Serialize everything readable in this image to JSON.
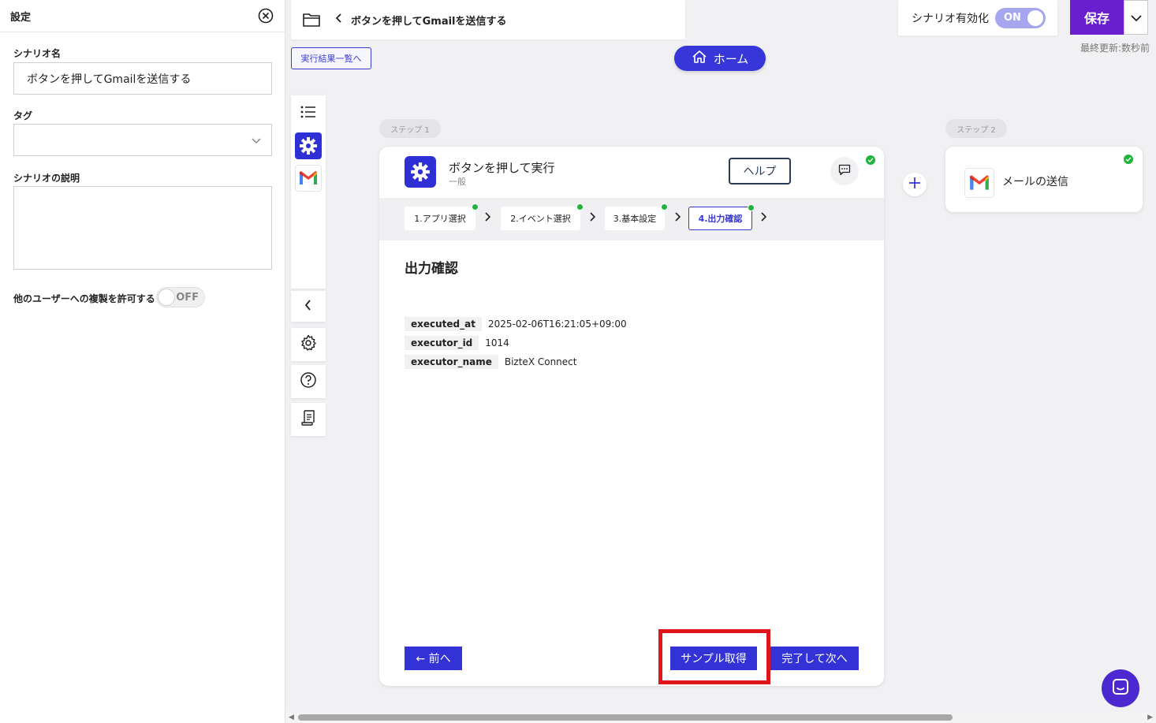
{
  "settings": {
    "title": "設定",
    "scenario_name_label": "シナリオ名",
    "scenario_name_value": "ボタンを押してGmailを送信する",
    "tag_label": "タグ",
    "description_label": "シナリオの説明",
    "allow_copy_label": "他のユーザーへの複製を許可する",
    "allow_copy_state": "OFF"
  },
  "topbar": {
    "scenario_name": "ボタンを押してGmailを送信する",
    "results_link": "実行結果一覧へ",
    "home_label": "ホーム",
    "enable_label": "シナリオ有効化",
    "enable_state": "ON",
    "save_label": "保存",
    "last_updated": "最終更新:数秒前"
  },
  "steps": {
    "step1_label": "ステップ 1",
    "step2_label": "ステップ 2"
  },
  "card": {
    "title": "ボタンを押して実行",
    "subtitle": "一般",
    "help_label": "ヘルプ",
    "tabs": [
      "1.アプリ選択",
      "2.イベント選択",
      "3.基本設定",
      "4.出力確認"
    ],
    "section_title": "出力確認",
    "outputs": [
      {
        "key": "executed_at",
        "value": "2025-02-06T16:21:05+09:00"
      },
      {
        "key": "executor_id",
        "value": "1014"
      },
      {
        "key": "executor_name",
        "value": "BizteX Connect"
      }
    ],
    "prev_label": "← 前へ",
    "sample_label": "サンプル取得",
    "next_label": "完了して次へ"
  },
  "card2": {
    "title": "メールの送信"
  },
  "colors": {
    "accent": "#3737d9",
    "save": "#6a1fcf",
    "success": "#1fb53b",
    "highlight": "#e0151b"
  }
}
